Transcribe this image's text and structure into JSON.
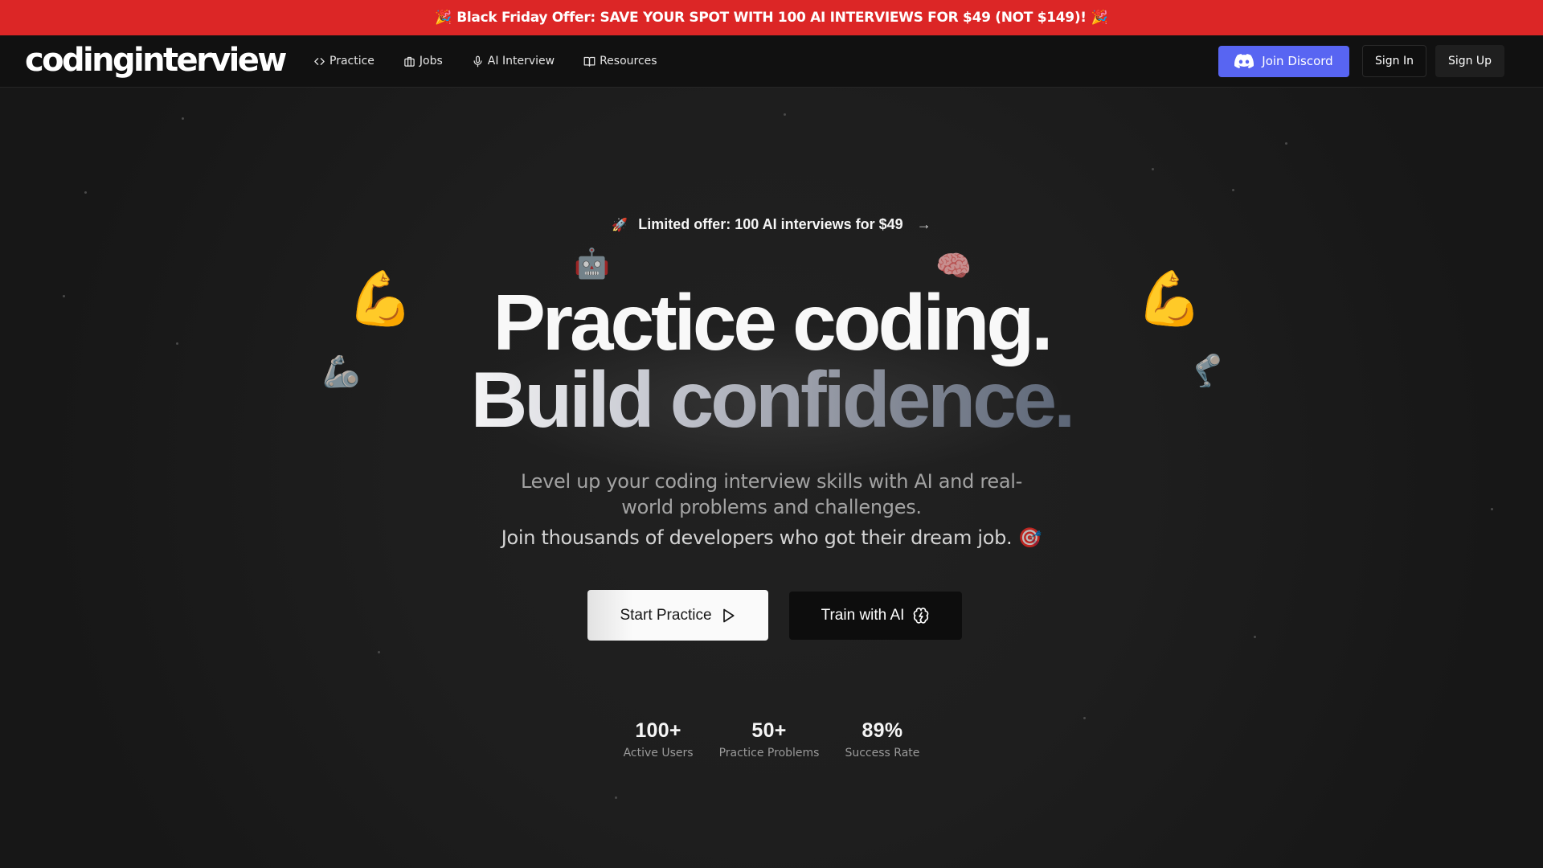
{
  "promo_bar": {
    "text": "Black Friday Offer: SAVE YOUR SPOT WITH 100 AI INTERVIEWS FOR $49 (NOT $149)!",
    "icon_left": "🎉",
    "icon_right": "🎉"
  },
  "header": {
    "logo": "codinginterview",
    "nav": [
      {
        "label": "Practice",
        "icon": "code-icon"
      },
      {
        "label": "Jobs",
        "icon": "briefcase-icon"
      },
      {
        "label": "AI Interview",
        "icon": "mic-icon"
      },
      {
        "label": "Resources",
        "icon": "book-icon"
      }
    ],
    "discord_label": "Join Discord",
    "signin_label": "Sign In",
    "signup_label": "Sign Up",
    "discord_color": "#5865F2"
  },
  "hero": {
    "offer": {
      "icon": "🚀",
      "text": "Limited offer: 100 AI interviews for $49",
      "arrow": "→"
    },
    "decor": {
      "robot": "🤖",
      "brain": "🧠",
      "flex": "💪",
      "mech_arm": "🦾",
      "mech_leg": "🦿"
    },
    "headline_line1": "Practice coding.",
    "headline_line2": "Build confidence.",
    "subtitle_line1": "Level up your coding interview skills with AI and real-",
    "subtitle_line2": "world problems and challenges.",
    "subtitle_line3": "Join thousands of developers who got their dream job.",
    "subtitle_icon": "🎯",
    "cta_primary": "Start Practice",
    "cta_secondary": "Train with AI",
    "stats": [
      {
        "value": "100+",
        "label": "Active Users"
      },
      {
        "value": "50+",
        "label": "Practice Problems"
      },
      {
        "value": "89%",
        "label": "Success Rate"
      }
    ]
  },
  "colors": {
    "promo_bg": "#dc2626",
    "header_bg": "#111111",
    "page_bg": "#1e1e1e"
  }
}
